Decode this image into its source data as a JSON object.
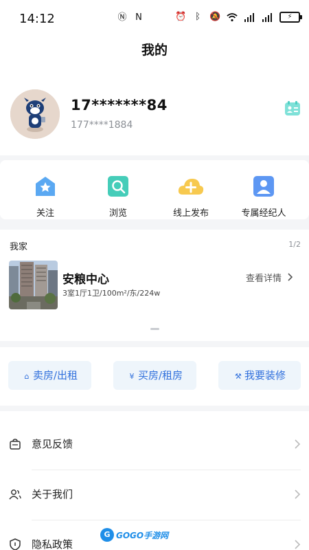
{
  "status_bar": {
    "time": "14:12",
    "left_icons": [
      "nfc-alt-icon",
      "nfc-icon"
    ],
    "right_icons": [
      "alarm-icon",
      "bluetooth-icon",
      "mute-icon",
      "wifi-icon",
      "signal-icon",
      "signal-icon"
    ],
    "battery_glyph": "⚡"
  },
  "header": {
    "title": "我的"
  },
  "profile": {
    "phone_masked": "17*******84",
    "phone_sub": "177****1884",
    "card_icon": "contact-card-icon"
  },
  "quick_actions": [
    {
      "label": "关注",
      "icon": "star-icon",
      "color": "#4fa0f0"
    },
    {
      "label": "浏览",
      "icon": "search-icon",
      "color": "#3ec5b5"
    },
    {
      "label": "线上发布",
      "icon": "cloud-plus-icon",
      "color": "#f5c24c"
    },
    {
      "label": "专属经纪人",
      "icon": "agent-icon",
      "color": "#4e8df2"
    }
  ],
  "my_home": {
    "title": "我家",
    "page": "1/2",
    "name": "安粮中心",
    "info": "3室1厅1卫/100m²/东/224w",
    "detail_link": "查看详情"
  },
  "services": [
    {
      "label": "卖房/出租",
      "icon": "house-icon",
      "glyph": "⌂"
    },
    {
      "label": "买房/租房",
      "icon": "yuan-icon",
      "glyph": "¥"
    },
    {
      "label": "我要装修",
      "icon": "roller-icon",
      "glyph": "⚒"
    }
  ],
  "menu": [
    {
      "label": "意见反馈",
      "icon": "feedback-bag-icon"
    },
    {
      "label": "关于我们",
      "icon": "users-icon"
    },
    {
      "label": "隐私政策",
      "icon": "shield-icon"
    }
  ],
  "watermark": {
    "badge": "G",
    "text": "GOGO手游网"
  }
}
